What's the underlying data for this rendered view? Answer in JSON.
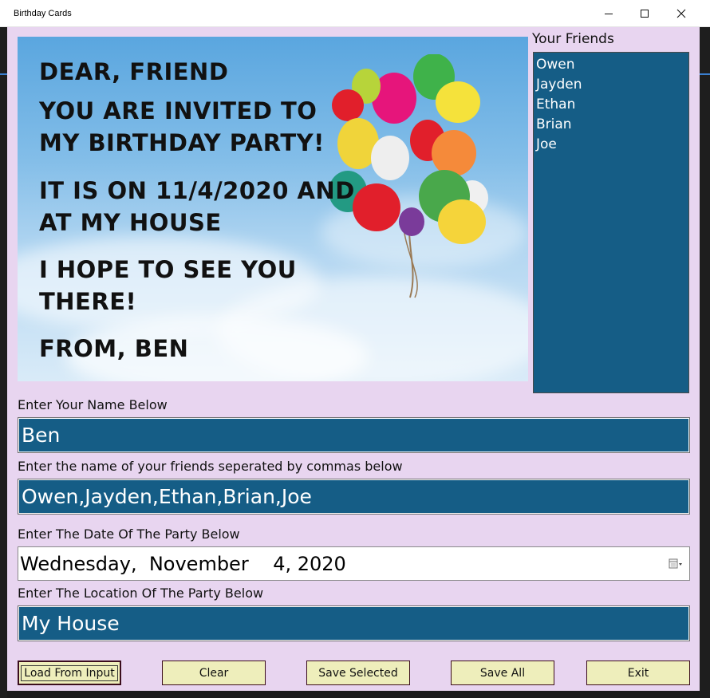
{
  "window": {
    "title": "Birthday Cards"
  },
  "card": {
    "line1": "Dear, Friend",
    "line2": "You are invited to",
    "line3": "my birthday party!",
    "line4": "It is on 11/4/2020 and",
    "line5": "at My House",
    "line6": "I hope to see you",
    "line7": "there!",
    "line8": "From, Ben"
  },
  "friends": {
    "label": "Your Friends",
    "items": [
      "Owen",
      "Jayden",
      "Ethan",
      "Brian",
      "Joe"
    ]
  },
  "form": {
    "name_label": "Enter Your Name Below",
    "name_value": "Ben",
    "friends_label": "Enter the name of your friends seperated by commas below",
    "friends_value": "Owen,Jayden,Ethan,Brian,Joe",
    "date_label": "Enter The Date Of The Party Below",
    "date_value": "Wednesday,  November    4, 2020",
    "location_label": "Enter The Location Of The Party Below",
    "location_value": "My House"
  },
  "buttons": {
    "load": "Load From Input",
    "clear": "Clear",
    "save_selected": "Save Selected",
    "save_all": "Save All",
    "exit": "Exit"
  },
  "colors": {
    "client_bg": "#e8d5f0",
    "textbox_bg": "#155d86",
    "button_bg": "#eeeebb",
    "button_border": "#3b0d1d"
  }
}
